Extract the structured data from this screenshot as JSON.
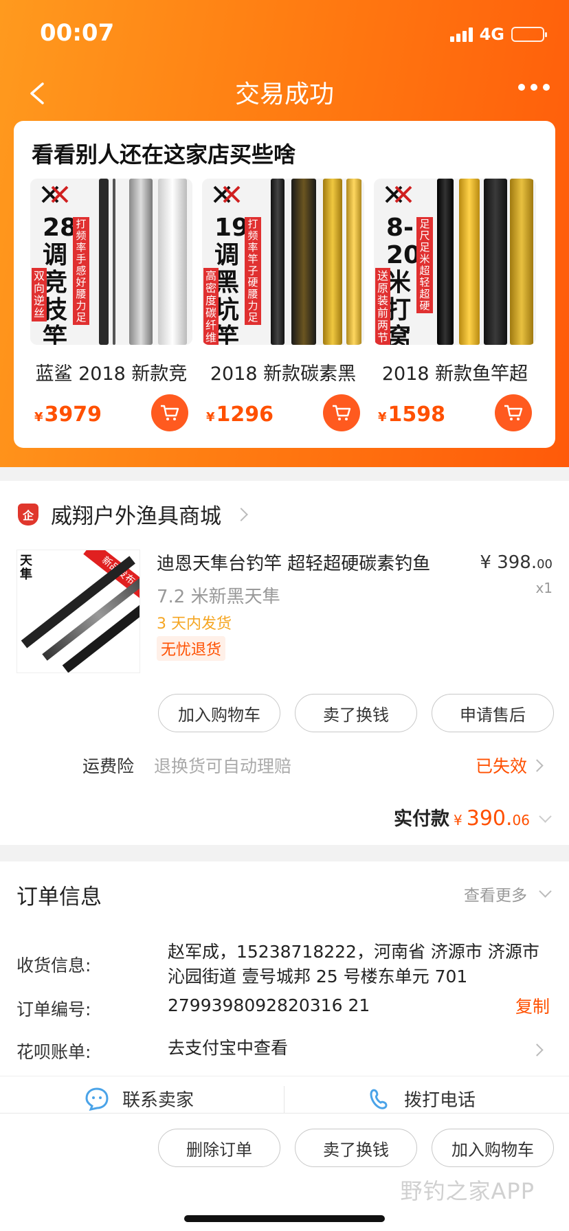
{
  "status_bar": {
    "time": "00:07",
    "network": "4G"
  },
  "nav": {
    "title": "交易成功"
  },
  "recommend": {
    "title": "看看别人还在这家店买些啥",
    "items": [
      {
        "name": "蓝鲨 2018 新款竞",
        "price": "3979",
        "poster_main": "28调竞技竿",
        "poster_side": "打频率 手感好 腰力足",
        "poster_bar": "双向逆丝"
      },
      {
        "name": "2018 新款碳素黑",
        "price": "1296",
        "poster_main": "19调黑坑竿",
        "poster_side": "打频率 竿子硬 腰力足",
        "poster_bar": "高密度碳纤维"
      },
      {
        "name": "2018 新款鱼竿超",
        "price": "1598",
        "poster_main": "8-20米打窝竿",
        "poster_side": "足尺足米 超轻超硬",
        "poster_bar": "送原装前两节"
      }
    ],
    "currency": "¥"
  },
  "shop": {
    "badge": "企",
    "name": "威翔户外渔具商城",
    "product": {
      "title": "迪恩天隼台钓竿 超轻超硬碳素钓鱼",
      "sku": "7.2 米新黑天隼",
      "ship": "3 天内发货",
      "tag": "无忧退货",
      "price_int": "¥ 398.",
      "price_dec": "00",
      "qty": "x1",
      "img_label": "天隼",
      "img_ribbon": "新品发布"
    },
    "actions": [
      "加入购物车",
      "卖了换钱",
      "申请售后"
    ],
    "insurance": {
      "label": "运费险",
      "desc": "退换货可自动理赔",
      "status": "已失效"
    },
    "paid": {
      "label": "实付款",
      "currency": "¥",
      "int": "390.",
      "dec": "06"
    }
  },
  "order": {
    "title": "订单信息",
    "more": "查看更多",
    "rows": [
      {
        "label": "收货信息:",
        "value": "赵军成，15238718222，河南省 济源市 济源市 沁园街道 壹号城邦 25 号楼东单元 701"
      },
      {
        "label": "订单编号:",
        "value": "2799398092820316 21"
      },
      {
        "label": "花呗账单:",
        "value": "去支付宝中查看"
      }
    ],
    "copy": "复制"
  },
  "contact": {
    "seller": "联系卖家",
    "call": "拨打电话"
  },
  "bottom_actions": [
    "删除订单",
    "卖了换钱",
    "加入购物车"
  ],
  "watermark": "野钓之家APP",
  "colors": {
    "accent": "#ff5000",
    "header_start": "#ff9a1e",
    "header_end": "#ff5a0a"
  }
}
